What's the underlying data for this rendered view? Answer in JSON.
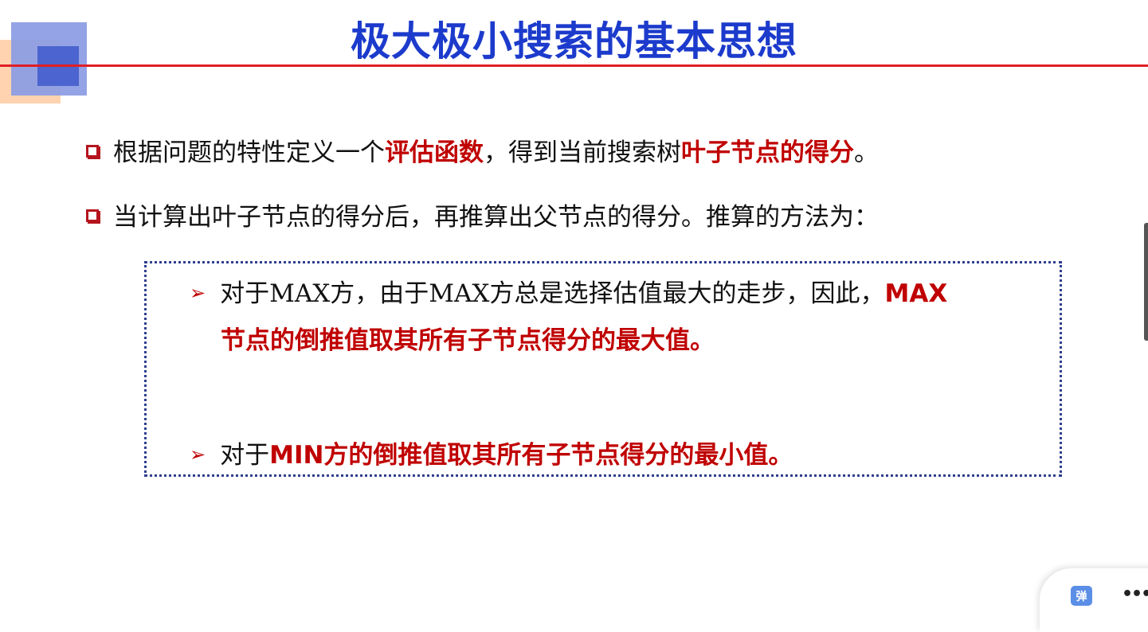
{
  "slide": {
    "title": "极大极小搜索的基本思想",
    "bullets": [
      {
        "parts": [
          "根据问题的特性定义一个",
          "评估函数",
          "，得到当前搜索树",
          "叶子节点的得分",
          "。"
        ]
      },
      {
        "text": "当计算出叶子节点的得分后，再推算出父节点的得分。推算的方法为："
      }
    ],
    "sub_points": [
      {
        "line1_normal": "对于MAX方，由于MAX方总是选择估值最大的走步，因此，",
        "line1_hl": "MAX",
        "line2_hl": "节点的倒推值取其所有子节点得分的最大值。"
      },
      {
        "normal": "对于",
        "hl": "MIN方的倒推值取其所有子节点得分的最小值。"
      }
    ]
  },
  "overlay": {
    "danmu_label": "弹",
    "more_label": "•••"
  },
  "colors": {
    "title": "#1c3bcc",
    "highlight": "#c00000",
    "rule": "#e01e24"
  },
  "icons": [
    "checkbox-bullet-icon",
    "arrow-bullet-icon",
    "more-icon"
  ]
}
